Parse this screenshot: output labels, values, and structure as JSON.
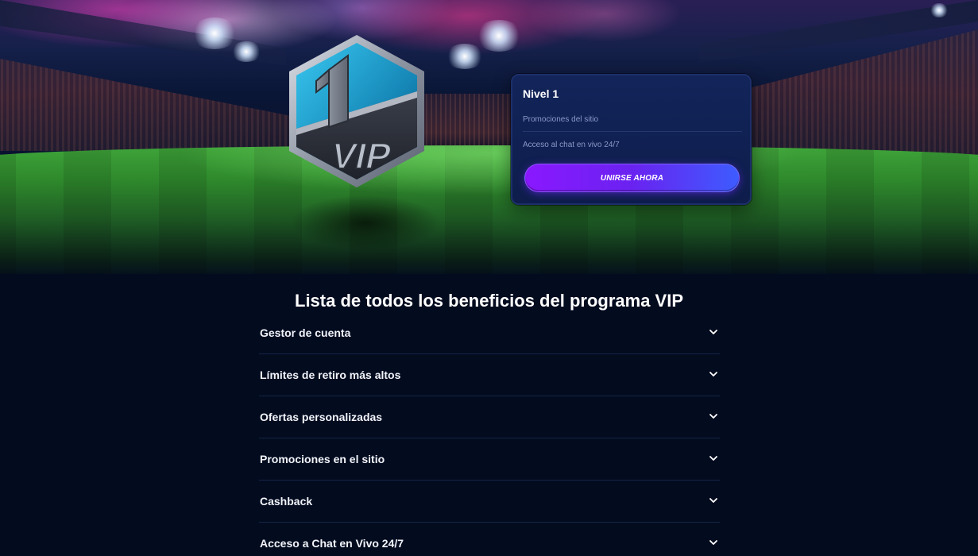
{
  "badge": {
    "level_number": "1",
    "label": "VIP"
  },
  "level_card": {
    "title": "Nivel 1",
    "perks": [
      "Promociones del sitio",
      "Acceso al chat en vivo 24/7"
    ],
    "join_button_label": "UNIRSE AHORA"
  },
  "benefits": {
    "title": "Lista de todos los beneficios del programa VIP",
    "items": [
      {
        "label": "Gestor de cuenta",
        "icon": "chevron-down-icon"
      },
      {
        "label": "Límites de retiro más altos",
        "icon": "chevron-down-icon"
      },
      {
        "label": "Ofertas personalizadas",
        "icon": "chevron-down-icon"
      },
      {
        "label": "Promociones en el sitio",
        "icon": "chevron-down-icon"
      },
      {
        "label": "Cashback",
        "icon": "chevron-down-icon"
      },
      {
        "label": "Acceso a Chat en Vivo 24/7",
        "icon": "chevron-down-icon"
      }
    ]
  },
  "colors": {
    "background": "#030b1f",
    "card_background": "#0e1d4b",
    "button_gradient_start": "#8a18ff",
    "button_gradient_end": "#3d5cff",
    "muted_text": "#8a99c8"
  }
}
